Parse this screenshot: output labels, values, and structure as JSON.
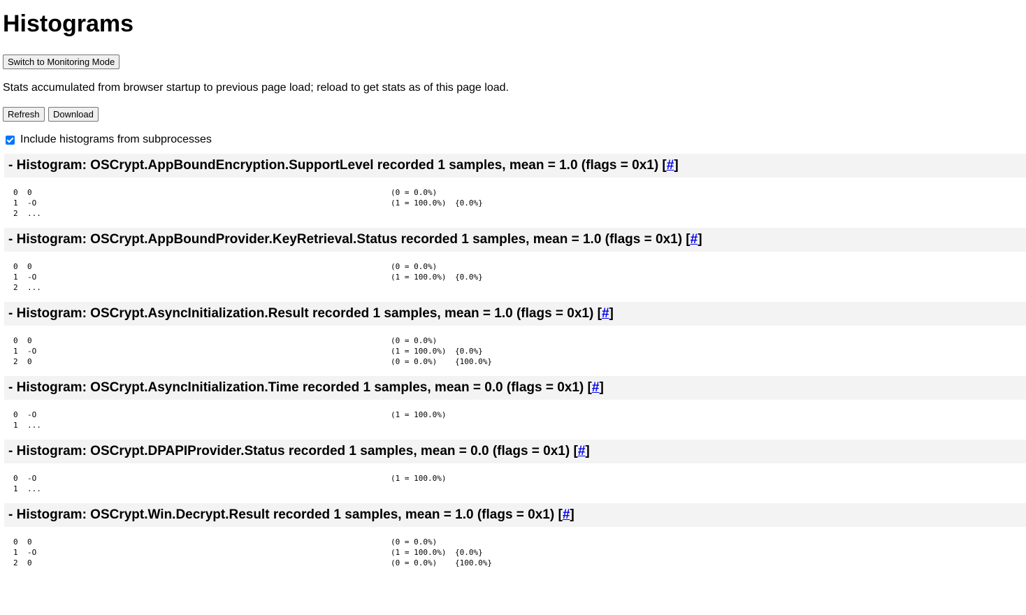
{
  "page": {
    "title": "Histograms",
    "monitor_button": "Switch to Monitoring Mode",
    "stats_text": "Stats accumulated from browser startup to previous page load; reload to get stats as of this page load.",
    "refresh_button": "Refresh",
    "download_button": "Download",
    "subprocess_label": "Include histograms from subprocesses",
    "subprocess_checked": true,
    "link_text": "#"
  },
  "histograms": [
    {
      "header": "- Histogram: OSCrypt.AppBoundEncryption.SupportLevel recorded 1 samples, mean = 1.0 (flags = 0x1)",
      "rows": [
        {
          "bucket": "0",
          "count": "0",
          "pct": "(0 = 0.0%)",
          "cum": ""
        },
        {
          "bucket": "1",
          "count": "-O",
          "pct": "(1 = 100.0%)",
          "cum": "{0.0%}"
        },
        {
          "bucket": "2",
          "count": "...",
          "pct": "",
          "cum": ""
        }
      ]
    },
    {
      "header": "- Histogram: OSCrypt.AppBoundProvider.KeyRetrieval.Status recorded 1 samples, mean = 1.0 (flags = 0x1)",
      "rows": [
        {
          "bucket": "0",
          "count": "0",
          "pct": "(0 = 0.0%)",
          "cum": ""
        },
        {
          "bucket": "1",
          "count": "-O",
          "pct": "(1 = 100.0%)",
          "cum": "{0.0%}"
        },
        {
          "bucket": "2",
          "count": "...",
          "pct": "",
          "cum": ""
        }
      ]
    },
    {
      "header": "- Histogram: OSCrypt.AsyncInitialization.Result recorded 1 samples, mean = 1.0 (flags = 0x1)",
      "rows": [
        {
          "bucket": "0",
          "count": "0",
          "pct": "(0 = 0.0%)",
          "cum": ""
        },
        {
          "bucket": "1",
          "count": "-O",
          "pct": "(1 = 100.0%)",
          "cum": "{0.0%}"
        },
        {
          "bucket": "2",
          "count": "0",
          "pct": "(0 = 0.0%)",
          "cum": "{100.0%}"
        }
      ]
    },
    {
      "header": "- Histogram: OSCrypt.AsyncInitialization.Time recorded 1 samples, mean = 0.0 (flags = 0x1)",
      "rows": [
        {
          "bucket": "0",
          "count": "-O",
          "pct": "(1 = 100.0%)",
          "cum": ""
        },
        {
          "bucket": "1",
          "count": "...",
          "pct": "",
          "cum": ""
        }
      ]
    },
    {
      "header": "- Histogram: OSCrypt.DPAPIProvider.Status recorded 1 samples, mean = 0.0 (flags = 0x1)",
      "rows": [
        {
          "bucket": "0",
          "count": "-O",
          "pct": "(1 = 100.0%)",
          "cum": ""
        },
        {
          "bucket": "1",
          "count": "...",
          "pct": "",
          "cum": ""
        }
      ]
    },
    {
      "header": "- Histogram: OSCrypt.Win.Decrypt.Result recorded 1 samples, mean = 1.0 (flags = 0x1)",
      "rows": [
        {
          "bucket": "0",
          "count": "0",
          "pct": "(0 = 0.0%)",
          "cum": ""
        },
        {
          "bucket": "1",
          "count": "-O",
          "pct": "(1 = 100.0%)",
          "cum": "{0.0%}"
        },
        {
          "bucket": "2",
          "count": "0",
          "pct": "(0 = 0.0%)",
          "cum": "{100.0%}"
        }
      ]
    }
  ]
}
